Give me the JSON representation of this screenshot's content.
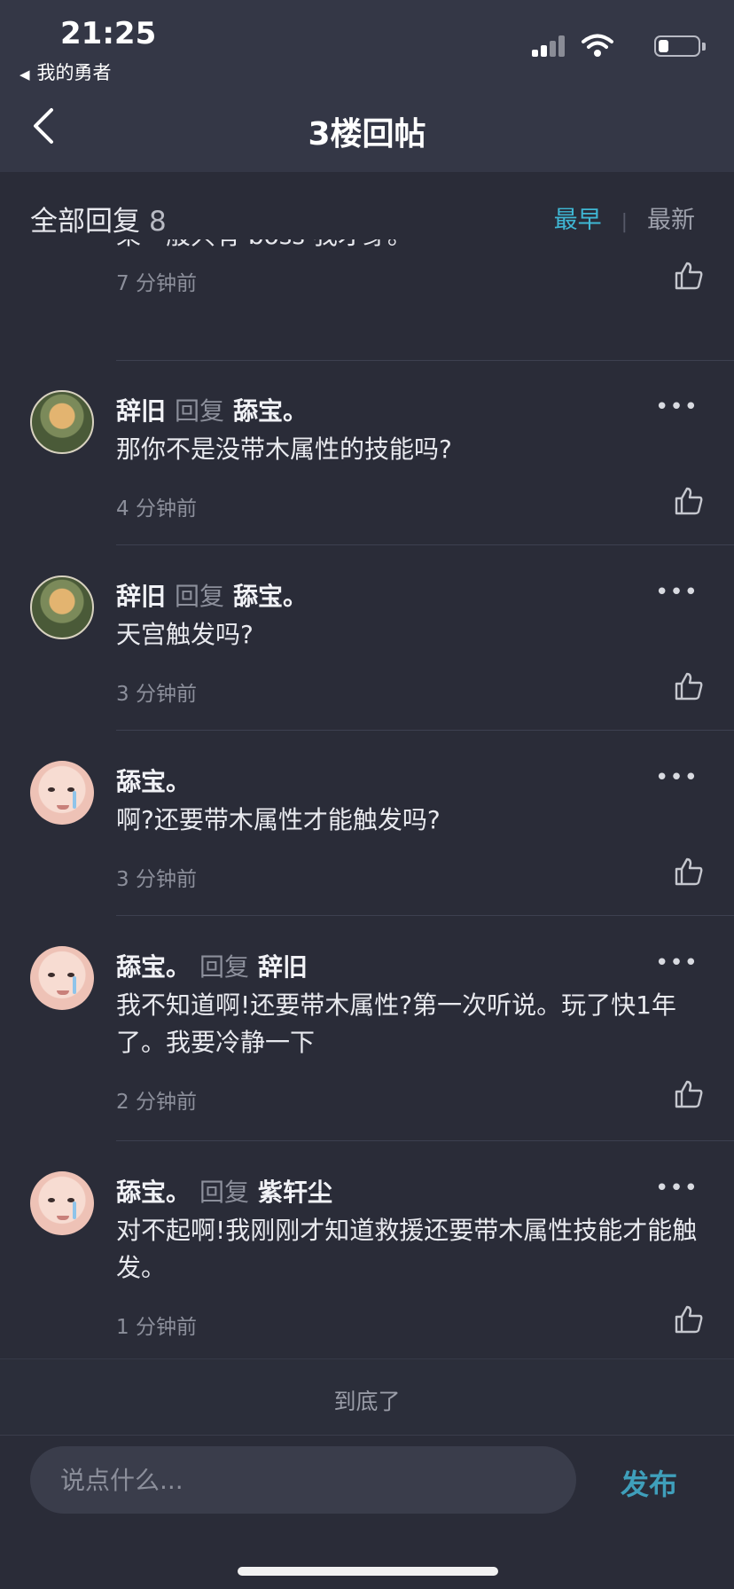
{
  "status_bar": {
    "time": "21:25",
    "back_app": "我的勇者"
  },
  "nav": {
    "title": "3楼回帖"
  },
  "header": {
    "title": "全部回复",
    "count": "8",
    "sort_earliest": "最早",
    "sort_separator": "|",
    "sort_latest": "最新"
  },
  "partial": {
    "text": "果一般只有 boss 我才穿。",
    "time": "7 分钟前"
  },
  "comments": [
    {
      "author": "辞旧",
      "verb": "回复",
      "target": "舔宝。",
      "text": "那你不是没带木属性的技能吗?",
      "time": "4 分钟前"
    },
    {
      "author": "辞旧",
      "verb": "回复",
      "target": "舔宝。",
      "text": "天宫触发吗?",
      "time": "3 分钟前"
    },
    {
      "author": "舔宝。",
      "verb": "",
      "target": "",
      "text": "啊?还要带木属性才能触发吗?",
      "time": "3 分钟前"
    },
    {
      "author": "舔宝。",
      "verb": "回复",
      "target": "辞旧",
      "text": "我不知道啊!还要带木属性?第一次听说。玩了快1年了。我要冷静一下",
      "time": "2 分钟前"
    },
    {
      "author": "舔宝。",
      "verb": "回复",
      "target": "紫轩尘",
      "text": "对不起啊!我刚刚才知道救援还要带木属性技能才能触发。",
      "time": "1 分钟前"
    }
  ],
  "more_glyph": "•••",
  "end_text": "到底了",
  "composer": {
    "placeholder": "说点什么...",
    "publish": "发布"
  },
  "colors": {
    "accent": "#3fb7d4",
    "background": "#2a2c38",
    "topbar": "#343746"
  }
}
